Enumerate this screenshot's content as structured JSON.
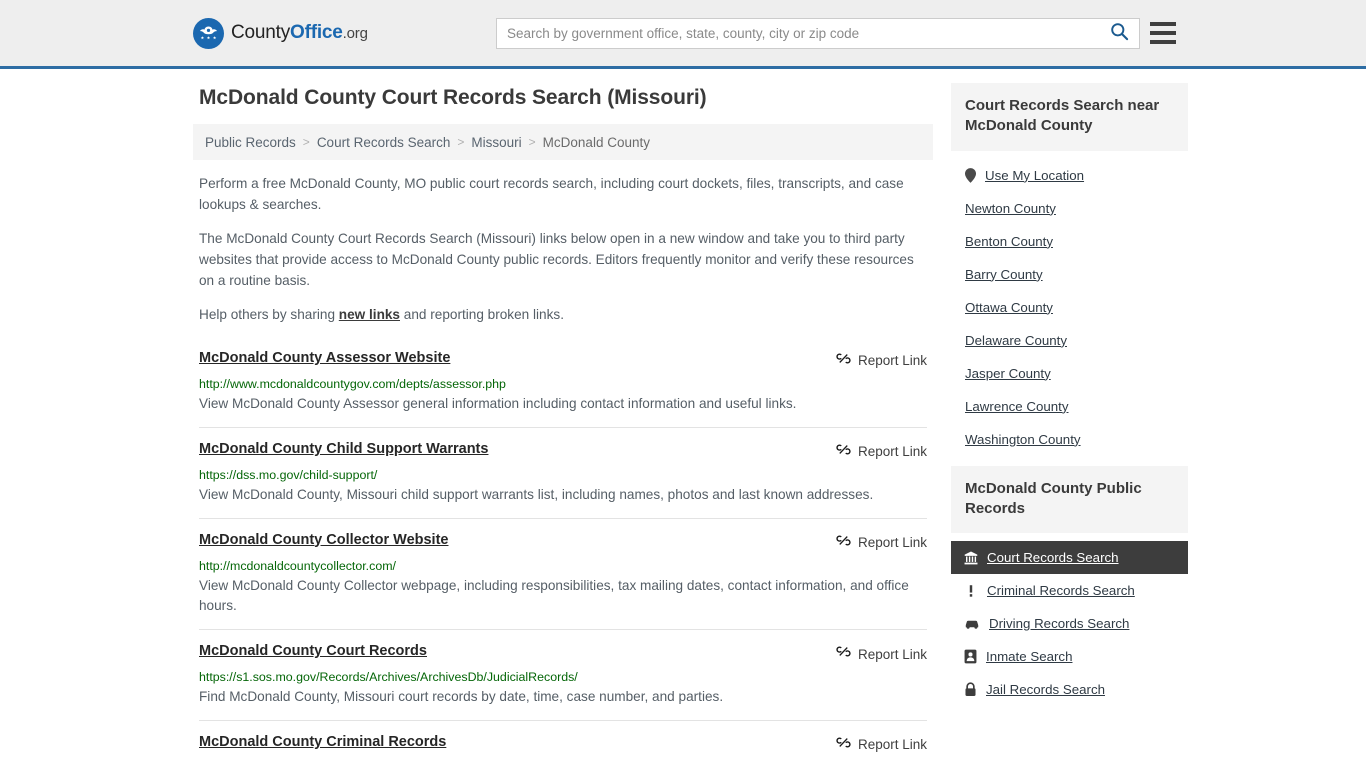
{
  "header": {
    "logo": {
      "icon": "eagle-emblem-icon",
      "text_part1": "County",
      "text_part2": "Office",
      "text_part3": ".org"
    },
    "search": {
      "placeholder": "Search by government office, state, county, city or zip code",
      "value": "",
      "icon": "search-icon"
    },
    "menu": {
      "icon": "hamburger-menu-icon"
    }
  },
  "page": {
    "title": "McDonald County Court Records Search (Missouri)"
  },
  "breadcrumb": {
    "separator": ">",
    "items": [
      {
        "label": "Public Records",
        "current": false
      },
      {
        "label": "Court Records Search",
        "current": false
      },
      {
        "label": "Missouri",
        "current": false
      },
      {
        "label": "McDonald County",
        "current": true
      }
    ]
  },
  "intro": {
    "p1": "Perform a free McDonald County, MO public court records search, including court dockets, files, transcripts, and case lookups & searches.",
    "p2": "The McDonald County Court Records Search (Missouri) links below open in a new window and take you to third party websites that provide access to McDonald County public records. Editors frequently monitor and verify these resources on a routine basis.",
    "p3_before": "Help others by sharing ",
    "p3_link": "new links",
    "p3_after": " and reporting broken links."
  },
  "results": {
    "report_label": "Report Link",
    "report_icon": "broken-link-icon",
    "items": [
      {
        "title": "McDonald County Assessor Website",
        "url": "http://www.mcdonaldcountygov.com/depts/assessor.php",
        "description": "View McDonald County Assessor general information including contact information and useful links."
      },
      {
        "title": "McDonald County Child Support Warrants",
        "url": "https://dss.mo.gov/child-support/",
        "description": "View McDonald County, Missouri child support warrants list, including names, photos and last known addresses."
      },
      {
        "title": "McDonald County Collector Website",
        "url": "http://mcdonaldcountycollector.com/",
        "description": "View McDonald County Collector webpage, including responsibilities, tax mailing dates, contact information, and office hours."
      },
      {
        "title": "McDonald County Court Records",
        "url": "https://s1.sos.mo.gov/Records/Archives/ArchivesDb/JudicialRecords/",
        "description": "Find McDonald County, Missouri court records by date, time, case number, and parties."
      },
      {
        "title": "McDonald County Criminal Records",
        "url": "",
        "description": ""
      }
    ]
  },
  "sidebar": {
    "nearby": {
      "heading": "Court Records Search near McDonald County",
      "items": [
        {
          "label": "Use My Location",
          "icon": "map-pin-icon"
        },
        {
          "label": "Newton County",
          "icon": ""
        },
        {
          "label": "Benton County",
          "icon": ""
        },
        {
          "label": "Barry County",
          "icon": ""
        },
        {
          "label": "Ottawa County",
          "icon": ""
        },
        {
          "label": "Delaware County",
          "icon": ""
        },
        {
          "label": "Jasper County",
          "icon": ""
        },
        {
          "label": "Lawrence County",
          "icon": ""
        },
        {
          "label": "Washington County",
          "icon": ""
        }
      ]
    },
    "public_records": {
      "heading": "McDonald County Public Records",
      "items": [
        {
          "label": "Court Records Search",
          "icon": "courthouse-icon",
          "active": true
        },
        {
          "label": "Criminal Records Search",
          "icon": "exclamation-icon",
          "active": false
        },
        {
          "label": "Driving Records Search",
          "icon": "car-icon",
          "active": false
        },
        {
          "label": "Inmate Search",
          "icon": "id-badge-icon",
          "active": false
        },
        {
          "label": "Jail Records Search",
          "icon": "lock-icon",
          "active": false
        }
      ]
    }
  },
  "colors": {
    "brand_blue": "#1b68b0",
    "header_bg": "#eeeeee",
    "header_border": "#2e6da4",
    "url_green": "#056608",
    "active_bg": "#3d3d3d"
  }
}
